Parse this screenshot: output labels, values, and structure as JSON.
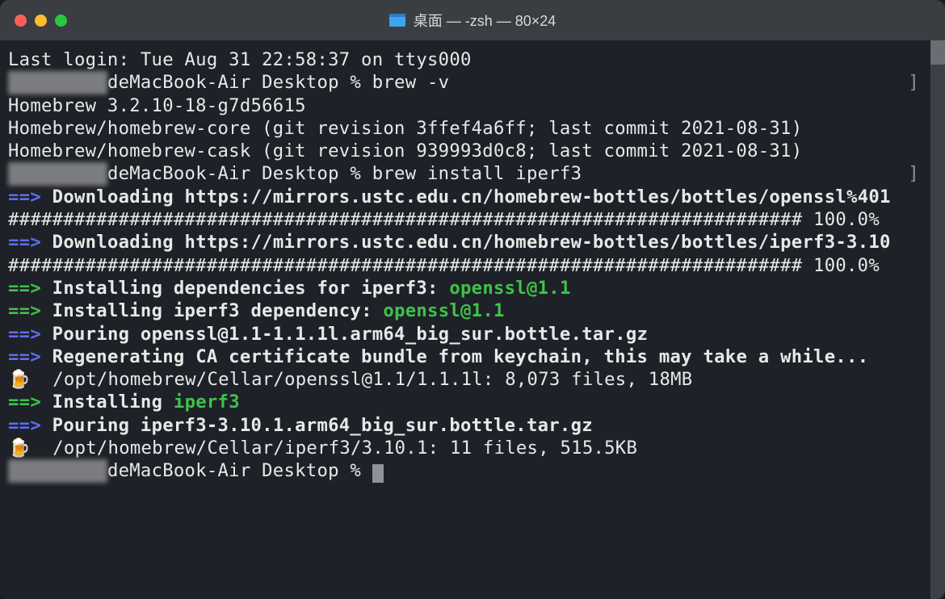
{
  "window": {
    "title": "桌面 — -zsh — 80×24"
  },
  "lines": {
    "last_login": "Last login: Tue Aug 31 22:58:37 on ttys000",
    "prompt_host_suffix": "deMacBook-Air Desktop % ",
    "cmd1": "brew -v",
    "brew_v1": "Homebrew 3.2.10-18-g7d56615",
    "brew_v2": "Homebrew/homebrew-core (git revision 3ffef4a6ff; last commit 2021-08-31)",
    "brew_v3": "Homebrew/homebrew-cask (git revision 939993d0c8; last commit 2021-08-31)",
    "cmd2": "brew install iperf3",
    "arrow": "==>",
    "dl1": "Downloading https://mirrors.ustc.edu.cn/homebrew-bottles/bottles/openssl%401",
    "progress1": "######################################################################## 100.0%",
    "dl2": "Downloading https://mirrors.ustc.edu.cn/homebrew-bottles/bottles/iperf3-3.10",
    "progress2": "######################################################################## 100.0%",
    "deps_pre": "Installing dependencies for iperf3: ",
    "deps_pkg": "openssl@1.1",
    "dep_pre": "Installing iperf3 dependency: ",
    "dep_pkg": "openssl@1.1",
    "pour1": "Pouring openssl@1.1-1.1.1l.arm64_big_sur.bottle.tar.gz",
    "regen": "Regenerating CA certificate bundle from keychain, this may take a while...",
    "beer": "🍺",
    "cellar1": "  /opt/homebrew/Cellar/openssl@1.1/1.1.1l: 8,073 files, 18MB",
    "inst_pre": "Installing ",
    "inst_pkg": "iperf3",
    "pour2": "Pouring iperf3-3.10.1.arm64_big_sur.bottle.tar.gz",
    "cellar2": "  /opt/homebrew/Cellar/iperf3/3.10.1: 11 files, 515.5KB",
    "rbracket": "]"
  }
}
